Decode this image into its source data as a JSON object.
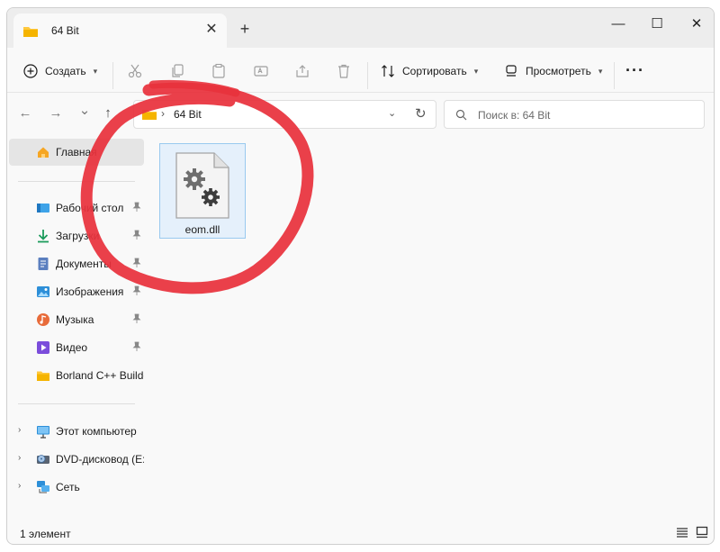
{
  "window": {
    "tab_title": "64 Bit",
    "tab_close": "✕",
    "new_tab": "+",
    "controls": {
      "minimize": "—",
      "maximize": "☐",
      "close": "✕"
    }
  },
  "toolbar": {
    "new_label": "Создать",
    "sort_label": "Сортировать",
    "view_label": "Просмотреть",
    "more_label": "···",
    "disabled_actions": [
      "cut-icon",
      "copy-icon",
      "paste-icon",
      "rename-icon",
      "share-icon",
      "delete-icon"
    ]
  },
  "address": {
    "back": "←",
    "forward": "→",
    "recent": "⌄",
    "up": "↑",
    "separator": "›",
    "path": "64 Bit",
    "dropdown": "⌄",
    "refresh": "↻"
  },
  "search": {
    "placeholder": "Поиск в: 64 Bit"
  },
  "sidebar": {
    "home": "Главная",
    "quick_access": [
      {
        "label": "Рабочий стол",
        "icon": "desktop-icon",
        "pinned": true
      },
      {
        "label": "Загрузки",
        "icon": "downloads-icon",
        "pinned": true
      },
      {
        "label": "Документы",
        "icon": "documents-icon",
        "pinned": true
      },
      {
        "label": "Изображения",
        "icon": "pictures-icon",
        "pinned": true
      },
      {
        "label": "Музыка",
        "icon": "music-icon",
        "pinned": true
      },
      {
        "label": "Видео",
        "icon": "video-icon",
        "pinned": true
      },
      {
        "label": "Borland C++ Builder",
        "icon": "folder-icon",
        "pinned": false
      }
    ],
    "locations": [
      {
        "label": "Этот компьютер",
        "icon": "computer-icon"
      },
      {
        "label": "DVD-дисковод (E:)",
        "icon": "dvd-icon"
      },
      {
        "label": "Сеть",
        "icon": "network-icon"
      }
    ],
    "expander": "›"
  },
  "content": {
    "files": [
      {
        "name": "eom.dll",
        "icon": "dll-file-icon",
        "selected": true
      }
    ]
  },
  "status": {
    "count": "1 элемент"
  },
  "colors": {
    "accent": "#0067c0",
    "selection": "#e5f0fb",
    "marker": "#e8323c",
    "folder": "#ffc83d"
  }
}
